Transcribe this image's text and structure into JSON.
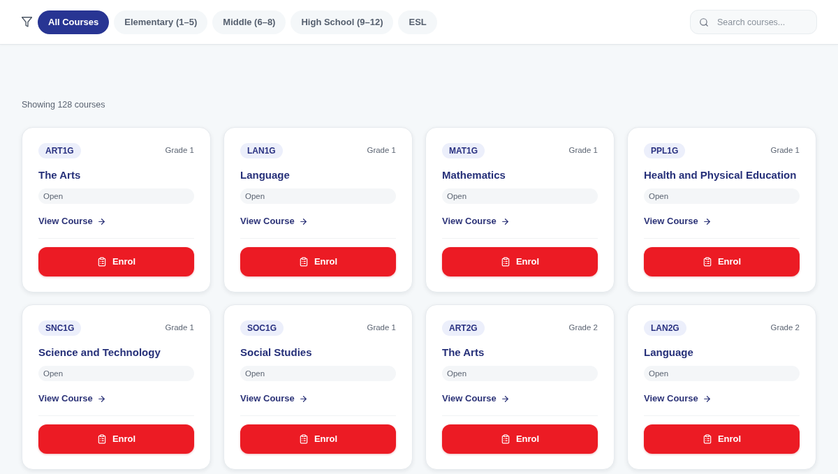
{
  "filters": [
    {
      "label": "All Courses",
      "selected": true
    },
    {
      "label": "Elementary (1–5)",
      "selected": false
    },
    {
      "label": "Middle (6–8)",
      "selected": false
    },
    {
      "label": "High School (9–12)",
      "selected": false
    },
    {
      "label": "ESL",
      "selected": false
    }
  ],
  "search": {
    "placeholder": "Search courses..."
  },
  "summary": "Showing 128 courses",
  "courses": [
    {
      "code": "ART1G",
      "grade": "Grade 1",
      "title": "The Arts",
      "status": "Open",
      "link": "View Course",
      "button": "Enrol"
    },
    {
      "code": "LAN1G",
      "grade": "Grade 1",
      "title": "Language",
      "status": "Open",
      "link": "View Course",
      "button": "Enrol"
    },
    {
      "code": "MAT1G",
      "grade": "Grade 1",
      "title": "Mathematics",
      "status": "Open",
      "link": "View Course",
      "button": "Enrol"
    },
    {
      "code": "PPL1G",
      "grade": "Grade 1",
      "title": "Health and Physical Education",
      "status": "Open",
      "link": "View Course",
      "button": "Enrol"
    },
    {
      "code": "SNC1G",
      "grade": "Grade 1",
      "title": "Science and Technology",
      "status": "Open",
      "link": "View Course",
      "button": "Enrol"
    },
    {
      "code": "SOC1G",
      "grade": "Grade 1",
      "title": "Social Studies",
      "status": "Open",
      "link": "View Course",
      "button": "Enrol"
    },
    {
      "code": "ART2G",
      "grade": "Grade 2",
      "title": "The Arts",
      "status": "Open",
      "link": "View Course",
      "button": "Enrol"
    },
    {
      "code": "LAN2G",
      "grade": "Grade 2",
      "title": "Language",
      "status": "Open",
      "link": "View Course",
      "button": "Enrol"
    }
  ]
}
